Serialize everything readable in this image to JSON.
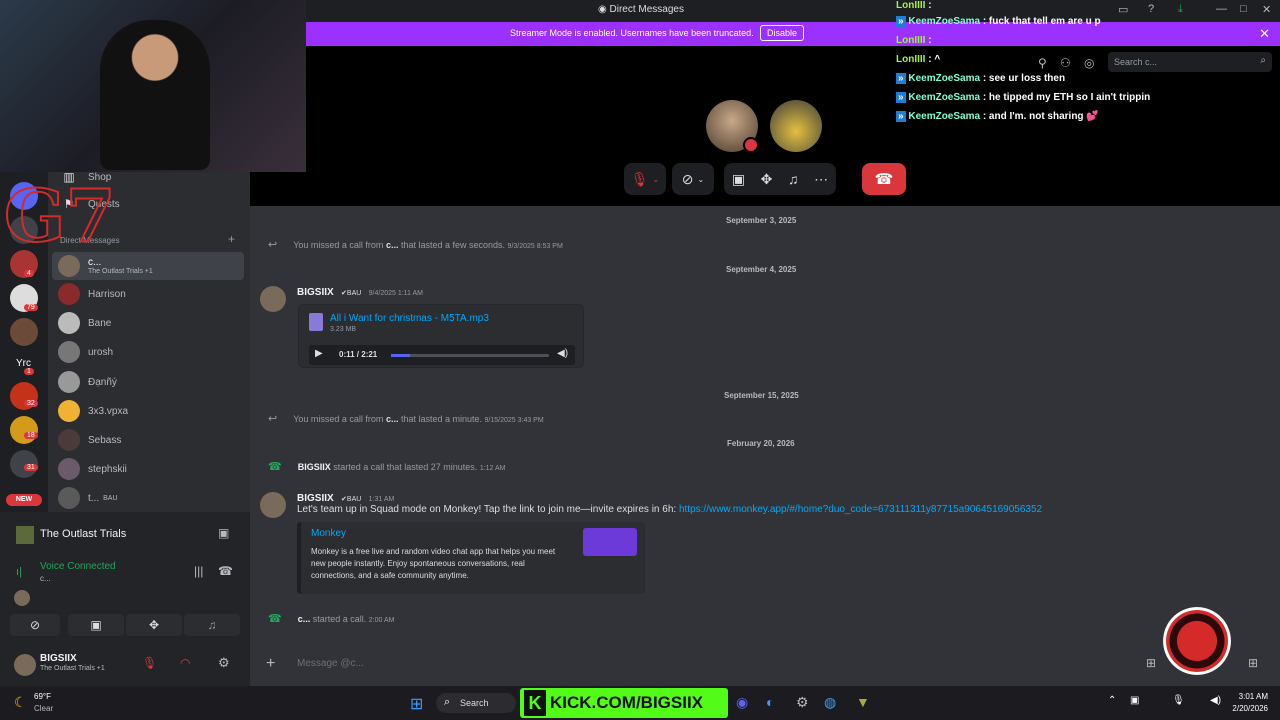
{
  "window": {
    "title": "Direct Messages"
  },
  "streamer_banner": {
    "message": "Streamer Mode is enabled. Usernames have been truncated.",
    "button": "Disable"
  },
  "call_header": {
    "search_placeholder": "Search c..."
  },
  "overlay": {
    "gang_tag": "G7",
    "kick_url": "KICK.COM/BIGSIIX"
  },
  "twitch_chat": [
    {
      "user": "LonIIII",
      "text": ":",
      "color": "#9ef542"
    },
    {
      "user": "KeemZoeSama",
      "text": ": fuck that tell em are u p",
      "color": "#7fffd4"
    },
    {
      "user": "LonIIII",
      "text": ":",
      "color": "#9ef542"
    },
    {
      "user": "LonIIII",
      "text": ": ^",
      "color": "#9ef542"
    },
    {
      "user": "KeemZoeSama",
      "text": ": see ur loss then",
      "color": "#7fffd4"
    },
    {
      "user": "KeemZoeSama",
      "text": ": he tipped my ETH so I ain't trippin",
      "color": "#7fffd4"
    },
    {
      "user": "KeemZoeSama",
      "text": ": and I'm. not sharing 💕",
      "color": "#7fffd4"
    }
  ],
  "sidebar": {
    "shop": "Shop",
    "quests": "Quests",
    "dm_header": "Direct Messages",
    "dms": [
      {
        "name": "c...",
        "sub": "The Outlast Trials +1"
      },
      {
        "name": "Harrison"
      },
      {
        "name": "Bane"
      },
      {
        "name": "urosh"
      },
      {
        "name": "Đạnñý"
      },
      {
        "name": "3x3.vpxa"
      },
      {
        "name": "Sebass"
      },
      {
        "name": "stephskii"
      },
      {
        "name": "t...",
        "tag": "BAU"
      }
    ],
    "server_badges": [
      "4",
      "79",
      "1",
      "32",
      "18",
      "31"
    ],
    "new_label": "NEW"
  },
  "voice": {
    "server": "The Outlast Trials",
    "status": "Voice Connected",
    "channel": "c..."
  },
  "user_panel": {
    "name": "BIGSIIX",
    "activity": "The Outlast Trials +1"
  },
  "chat": {
    "dates": [
      "September 3, 2025",
      "September 4, 2025",
      "September 15, 2025",
      "February 20, 2026"
    ],
    "missed1": {
      "prefix": "You missed a call from ",
      "user": "c...",
      "suffix": " that lasted a few seconds.",
      "time": "9/3/2025 8:53 PM"
    },
    "msg1": {
      "user": "BIGSIIX",
      "tag": "BAU",
      "time": "9/4/2025 1:11 AM",
      "file": "All i Want for christmas - M5TA.mp3",
      "size": "3.23 MB",
      "progress": "0:11 / 2:21"
    },
    "missed2": {
      "prefix": "You missed a call from ",
      "user": "c...",
      "suffix": " that lasted a minute.",
      "time": "9/15/2025 3:43 PM"
    },
    "call1": {
      "user": "BIGSIIX",
      "text": " started a call that lasted 27 minutes.",
      "time": "1:12 AM"
    },
    "msg2": {
      "user": "BIGSIIX",
      "tag": "BAU",
      "time": "1:31 AM",
      "text": "Let's team up in Squad mode on Monkey! Tap the link to join me—invite expires in 6h: ",
      "link": "https://www.monkey.app/#/home?duo_code=673111311y87715a90645169056352"
    },
    "embed": {
      "title": "Monkey",
      "desc": "Monkey is a free live and random video chat app that helps you meet new people instantly. Enjoy spontaneous conversations, real connections, and a safe community anytime."
    },
    "call2": {
      "user": "c...",
      "text": " started a call.",
      "time": "2:00 AM"
    },
    "composer_placeholder": "Message @c..."
  },
  "taskbar": {
    "weather_temp": "69°F",
    "weather_desc": "Clear",
    "search": "Search",
    "time": "3:01 AM",
    "date": "2/20/2026"
  },
  "colors": {
    "accent": "#9b30ff",
    "danger": "#da373c",
    "link": "#00a8fc",
    "green": "#23a55a"
  }
}
